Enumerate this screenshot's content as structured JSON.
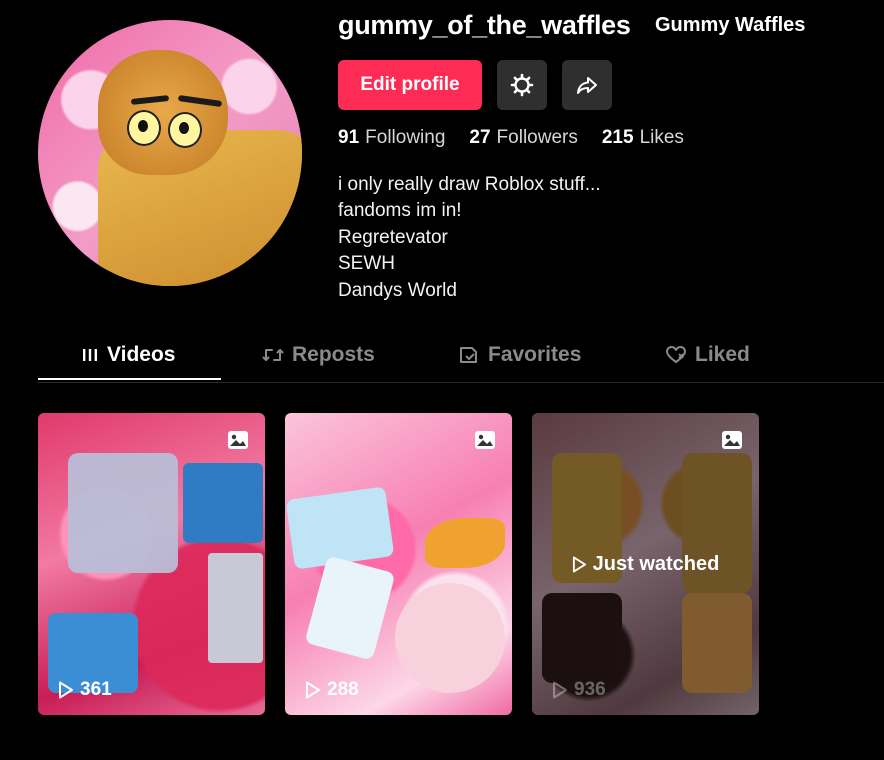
{
  "profile": {
    "username": "gummy_of_the_waffles",
    "nickname": "Gummy Waffles",
    "edit_label": "Edit profile",
    "stats": {
      "following_count": "91",
      "following_label": "Following",
      "followers_count": "27",
      "followers_label": "Followers",
      "likes_count": "215",
      "likes_label": "Likes"
    },
    "bio": [
      "i only really draw Roblox stuff...",
      "fandoms im in!",
      "Regretevator",
      "SEWH",
      "Dandys World"
    ]
  },
  "tabs": [
    {
      "label": "Videos",
      "icon": "grid-icon",
      "active": true
    },
    {
      "label": "Reposts",
      "icon": "repost-icon",
      "active": false
    },
    {
      "label": "Favorites",
      "icon": "bookmark-icon",
      "active": false
    },
    {
      "label": "Liked",
      "icon": "heart-icon",
      "active": false
    }
  ],
  "videos": [
    {
      "views": "361",
      "photo": true
    },
    {
      "views": "288",
      "photo": true
    },
    {
      "views": "936",
      "photo": true,
      "overlay_text": "Just watched"
    }
  ],
  "colors": {
    "accent": "#fe2c55",
    "background": "#000000",
    "button_dark": "#2f2f2f",
    "tab_inactive": "#8a8a8a"
  }
}
